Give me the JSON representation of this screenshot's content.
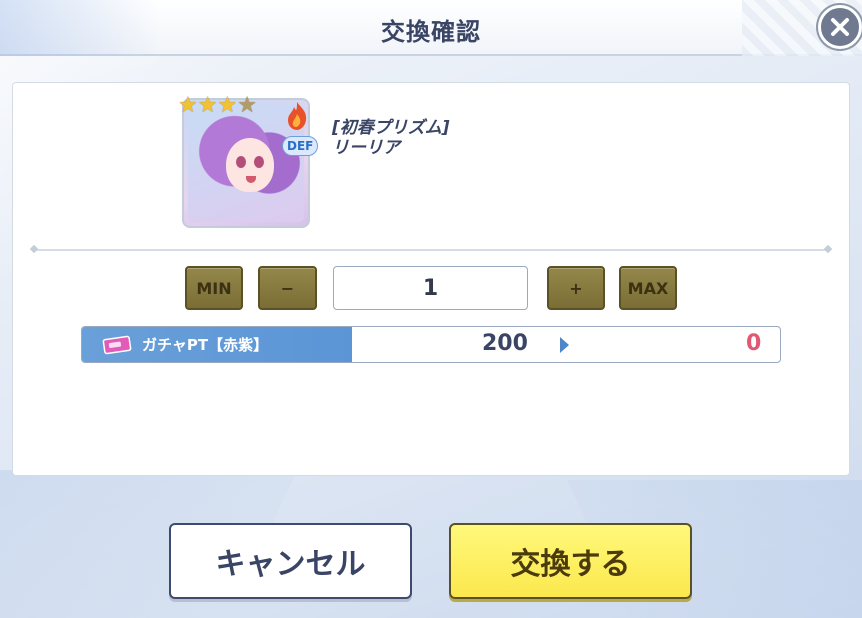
{
  "header": {
    "title": "交換確認"
  },
  "item": {
    "name_line1": "[初春プリズム]",
    "name_line2": "リーリア",
    "rarity_stars": 3,
    "rarity_max": 4,
    "attribute_badge": "DEF"
  },
  "quantity": {
    "min_label": "MIN",
    "minus_label": "−",
    "value": "1",
    "plus_label": "+",
    "max_label": "MAX"
  },
  "cost": {
    "currency_label": "ガチャPT【赤紫】",
    "current": "200",
    "after": "0"
  },
  "actions": {
    "cancel_label": "キャンセル",
    "confirm_label": "交換する"
  },
  "colors": {
    "title_text": "#3a4566",
    "step_button": "#8a7e42",
    "cost_label_bg": "#5b95d6",
    "after_value": "#e05873",
    "confirm_button": "#fbe84e"
  }
}
